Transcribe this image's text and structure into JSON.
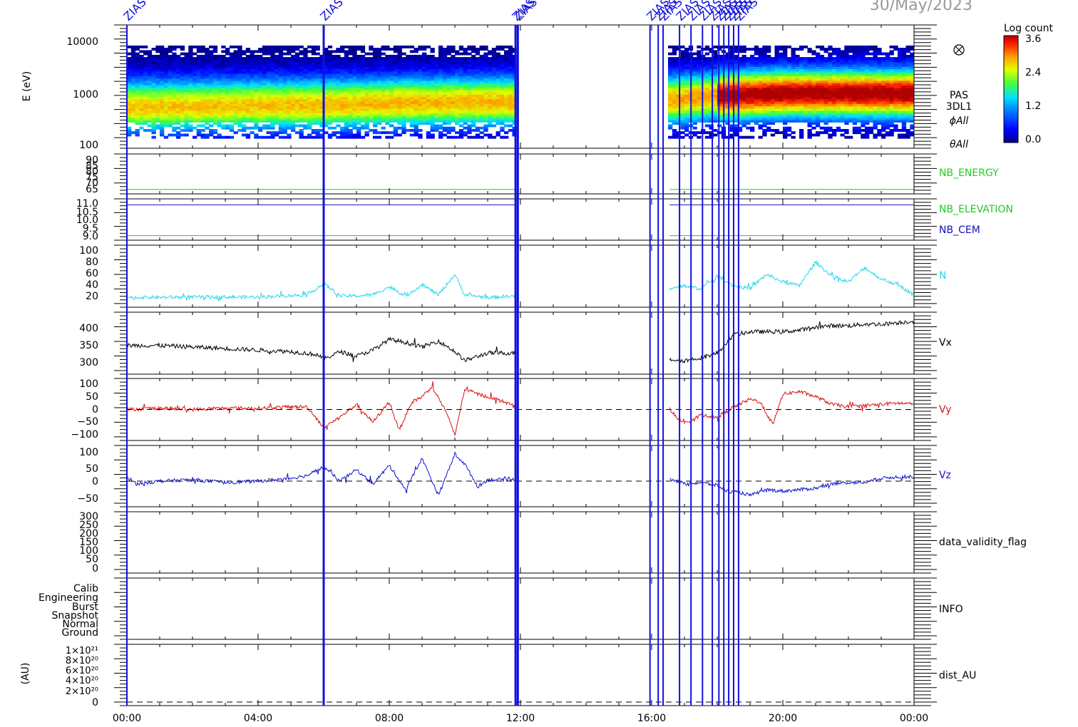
{
  "date": "30/May/2023",
  "colorbar": {
    "title": "Log count",
    "ticks": [
      "3.6",
      "2.4",
      "1.2",
      "0.0"
    ]
  },
  "spectrogram": {
    "ylabel": "E (eV)",
    "yticks": [
      "10000",
      "1000",
      "100"
    ],
    "right_labels": [
      "PAS",
      "3DL1",
      "ϕAll",
      "θAll"
    ],
    "dominant_energy_eV": {
      "early": 500,
      "late": 900
    }
  },
  "panels": {
    "nb_energy": {
      "yticks": [
        "90",
        "85",
        "80",
        "75",
        "70",
        "65"
      ],
      "label": "NB_ENERGY",
      "label_color": "#22cc22"
    },
    "nb_elev": {
      "yticks": [
        "11.0",
        "10.5",
        "10.0",
        "9.5",
        "9.0"
      ],
      "labels": [
        "NB_ELEVATION",
        "NB_CEM"
      ],
      "label_colors": [
        "#22cc22",
        "#1111bb"
      ]
    },
    "n": {
      "yticks": [
        "100",
        "80",
        "60",
        "40",
        "20"
      ],
      "label": "N",
      "color": "#22d8e8"
    },
    "vx": {
      "yticks": [
        "400",
        "350",
        "300"
      ],
      "label": "Vx",
      "color": "#000000"
    },
    "vy": {
      "yticks": [
        "100",
        "50",
        "0",
        "−50",
        "−100"
      ],
      "label": "Vy",
      "color": "#dd1111"
    },
    "vz": {
      "yticks": [
        "100",
        "50",
        "0",
        "−50"
      ],
      "label": "Vz",
      "color": "#1111cc"
    },
    "validity": {
      "yticks": [
        "300",
        "250",
        "200",
        "150",
        "100",
        "50",
        "0"
      ],
      "label": "data_validity_flag"
    },
    "info": {
      "yticks": [
        "Calib",
        "Engineering",
        "Burst",
        "Snapshot",
        "Normal",
        "Ground"
      ],
      "label": "INFO"
    },
    "dist": {
      "ylabel": "(AU)",
      "yticks": [
        "1×10²¹",
        "8×10²⁰",
        "6×10²⁰",
        "4×10²⁰",
        "2×10²⁰",
        "0"
      ],
      "label": "dist_AU"
    }
  },
  "xticks": [
    "00:00",
    "04:00",
    "08:00",
    "12:00",
    "16:00",
    "20:00",
    "00:00"
  ],
  "event_lines": {
    "color": "#1111dd",
    "label": "ZIAS",
    "times_h": [
      0.0,
      6.0,
      11.85,
      11.92,
      15.95,
      16.2,
      16.35,
      16.85,
      17.2,
      17.55,
      17.85,
      18.05,
      18.2,
      18.35,
      18.5,
      18.65
    ]
  },
  "chart_data": [
    {
      "type": "heatmap",
      "title": "",
      "ylabel": "E (eV)",
      "yscale": "log",
      "ylim": [
        100,
        15000
      ],
      "xlim_h": [
        0,
        24
      ],
      "colorbar_label": "Log count",
      "colorbar_range": [
        0.0,
        3.6
      ],
      "data_gaps_h": [
        [
          11.85,
          16.55
        ]
      ],
      "peak_energy_eV": {
        "00:00": 500,
        "06:00": 550,
        "09:00": 600,
        "16:30": 650,
        "18:00": 800,
        "20:00": 900,
        "24:00": 900
      }
    },
    {
      "type": "line",
      "ylabel": "N",
      "ylim": [
        5,
        105
      ],
      "gap_h": [
        11.85,
        16.55
      ],
      "series": [
        {
          "name": "N",
          "x": [
            0,
            2,
            4,
            5.5,
            6,
            6.5,
            7,
            7.5,
            8,
            8.5,
            9,
            9.5,
            10,
            10.3,
            11,
            11.85,
            16.55,
            17,
            17.5,
            18,
            18.5,
            19,
            19.5,
            20,
            20.5,
            21,
            21.5,
            22,
            22.5,
            23,
            23.5,
            24
          ],
          "y": [
            17,
            18,
            18,
            22,
            42,
            20,
            20,
            22,
            36,
            20,
            40,
            22,
            58,
            22,
            17,
            20,
            32,
            38,
            33,
            55,
            38,
            33,
            58,
            45,
            38,
            80,
            55,
            45,
            70,
            50,
            40,
            22
          ]
        }
      ]
    },
    {
      "type": "line",
      "ylabel": "Vx",
      "ylim": [
        275,
        460
      ],
      "gap_h": [
        11.85,
        16.55
      ],
      "series": [
        {
          "name": "Vx",
          "x": [
            0,
            1,
            2,
            3,
            4,
            5,
            5.8,
            6,
            6.5,
            7,
            7.5,
            8,
            8.5,
            9,
            9.5,
            10,
            10.3,
            11,
            11.85,
            16.55,
            17,
            17.5,
            18,
            18.5,
            19,
            19.5,
            20,
            20.5,
            21,
            21.5,
            22,
            22.5,
            23,
            23.5,
            24
          ],
          "y": [
            360,
            360,
            355,
            350,
            345,
            340,
            330,
            315,
            340,
            325,
            345,
            380,
            370,
            355,
            375,
            340,
            310,
            335,
            335,
            315,
            310,
            320,
            335,
            395,
            405,
            405,
            405,
            410,
            420,
            425,
            425,
            430,
            430,
            435,
            440
          ]
        }
      ]
    },
    {
      "type": "line",
      "ylabel": "Vy",
      "ylim": [
        -110,
        110
      ],
      "zero_line": true,
      "gap_h": [
        11.85,
        16.55
      ],
      "series": [
        {
          "name": "Vy",
          "x": [
            0,
            1,
            2,
            3,
            4,
            5,
            5.5,
            6,
            6.5,
            7,
            7.5,
            8,
            8.3,
            8.7,
            9,
            9.3,
            9.7,
            10,
            10.3,
            10.7,
            11,
            11.5,
            11.85,
            16.55,
            16.8,
            17.2,
            17.5,
            18,
            18.5,
            19,
            19.3,
            19.7,
            20,
            20.5,
            21,
            21.5,
            22,
            22.5,
            23,
            23.5,
            24
          ],
          "y": [
            0,
            5,
            0,
            5,
            5,
            10,
            10,
            -70,
            -30,
            20,
            -50,
            30,
            -80,
            30,
            50,
            90,
            0,
            -100,
            80,
            60,
            50,
            30,
            10,
            5,
            -40,
            -50,
            -20,
            -30,
            10,
            40,
            30,
            -60,
            60,
            70,
            50,
            20,
            10,
            15,
            20,
            25,
            20
          ]
        }
      ]
    },
    {
      "type": "line",
      "ylabel": "Vz",
      "ylim": [
        -80,
        115
      ],
      "zero_line": true,
      "gap_h": [
        11.85,
        16.55
      ],
      "series": [
        {
          "name": "Vz",
          "x": [
            0,
            0.3,
            1,
            2,
            3,
            4,
            5,
            5.5,
            6,
            6.5,
            7,
            7.5,
            8,
            8.5,
            9,
            9.5,
            10,
            10.3,
            10.7,
            11,
            11.85,
            16.55,
            17,
            17.5,
            18,
            18.3,
            18.7,
            19,
            19.5,
            20,
            20.5,
            21,
            21.5,
            22,
            22.5,
            23,
            23.5,
            24
          ],
          "y": [
            15,
            -10,
            0,
            5,
            -5,
            0,
            10,
            20,
            50,
            0,
            40,
            -10,
            55,
            -30,
            80,
            -50,
            95,
            60,
            -20,
            5,
            5,
            10,
            -10,
            -5,
            -15,
            -35,
            -40,
            -50,
            -30,
            -35,
            -30,
            -25,
            -10,
            -5,
            -5,
            10,
            15,
            15
          ]
        }
      ]
    },
    {
      "type": "line",
      "ylabel": "NB_ENERGY",
      "ylim": [
        63,
        92
      ],
      "series": [
        {
          "name": "NB_ENERGY",
          "segments_h": [
            [
              0,
              11.85
            ],
            [
              16.55,
              24
            ]
          ],
          "y": 65.5
        }
      ]
    },
    {
      "type": "line",
      "ylabel": "NB_ELEVATION / NB_CEM",
      "ylim": [
        8.8,
        11.2
      ],
      "series": [
        {
          "name": "NB_ELEVATION",
          "segments_h": [
            [
              0,
              11.85
            ],
            [
              16.55,
              24
            ]
          ],
          "y": 9.0
        },
        {
          "name": "NB_CEM",
          "segments_h": [
            [
              0,
              11.85
            ],
            [
              16.55,
              24
            ]
          ],
          "y": 11.0
        }
      ]
    },
    {
      "type": "line",
      "ylabel": "(AU)",
      "ylim": [
        0,
        1.1e+21
      ],
      "series": [
        {
          "name": "dist_AU",
          "style": "dashed",
          "y": 0
        }
      ]
    }
  ]
}
